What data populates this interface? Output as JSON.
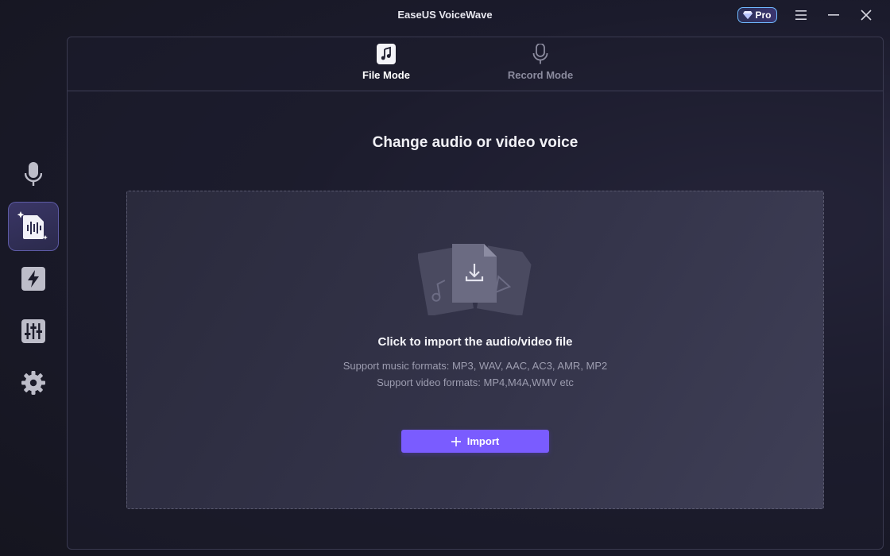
{
  "app": {
    "title": "EaseUS VoiceWave",
    "pro_label": "Pro"
  },
  "window_controls": [
    "menu-icon",
    "minimize-icon",
    "close-icon"
  ],
  "sidebar": {
    "items": [
      {
        "icon": "microphone-icon",
        "active": false
      },
      {
        "icon": "voice-file-icon",
        "active": true
      },
      {
        "icon": "lightning-icon",
        "active": false
      },
      {
        "icon": "equalizer-icon",
        "active": false
      },
      {
        "icon": "gear-icon",
        "active": false
      }
    ]
  },
  "modes": {
    "tabs": [
      {
        "label": "File Mode",
        "icon": "music-file-icon",
        "active": true
      },
      {
        "label": "Record Mode",
        "icon": "microphone-icon",
        "active": false
      }
    ]
  },
  "main": {
    "heading": "Change audio or video voice",
    "dropzone": {
      "title": "Click to import the audio/video file",
      "music_formats": "Support music formats: MP3, WAV, AAC, AC3, AMR, MP2",
      "video_formats": "Support video formats: MP4,M4A,WMV etc",
      "import_label": "Import"
    }
  },
  "colors": {
    "accent": "#7a5cff",
    "pro_border": "#6fb9ff",
    "background": "#1b1b2c",
    "inactive_text": "#8b8b9e"
  }
}
